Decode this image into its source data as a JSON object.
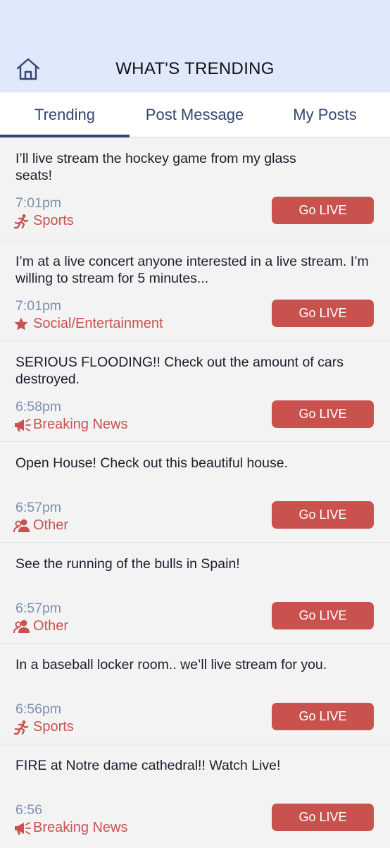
{
  "header": {
    "title": "WHAT'S TRENDING"
  },
  "tabs": [
    {
      "label": "Trending",
      "active": true
    },
    {
      "label": "Post Message",
      "active": false
    },
    {
      "label": "My Posts",
      "active": false
    }
  ],
  "posts": [
    {
      "message": "I’ll live stream the hockey game from my glass seats!",
      "time": "7:01pm",
      "category": "Sports",
      "category_icon": "running-icon",
      "button": "Go LIVE"
    },
    {
      "message": "I’m at a live concert anyone interested in a live stream. I’m willing to stream for 5 minutes...",
      "time": "7:01pm",
      "category": "Social/Entertainment",
      "category_icon": "star-icon",
      "button": "Go LIVE"
    },
    {
      "message": "SERIOUS FLOODING!! Check out the amount of cars destroyed.",
      "time": "6:58pm",
      "category": "Breaking News",
      "category_icon": "megaphone-icon",
      "button": "Go LIVE"
    },
    {
      "message": "Open House! Check out this beautiful house.",
      "time": "6:57pm",
      "category": "Other",
      "category_icon": "users-icon",
      "button": "Go LIVE"
    },
    {
      "message": "See the running of the bulls in Spain!",
      "time": "6:57pm",
      "category": "Other",
      "category_icon": "users-icon",
      "button": "Go LIVE"
    },
    {
      "message": "In a baseball locker room.. we’ll live stream for you.",
      "time": "6:56pm",
      "category": "Sports",
      "category_icon": "running-icon",
      "button": "Go LIVE"
    },
    {
      "message": "FIRE at Notre dame cathedral!! Watch Live!",
      "time": "6:56",
      "category": "Breaking News",
      "category_icon": "megaphone-icon",
      "button": "Go LIVE"
    }
  ],
  "colors": {
    "header_bg": "#dfe9fb",
    "accent": "#c9524f",
    "tab_text": "#34466f",
    "time_text": "#7f91ae"
  }
}
